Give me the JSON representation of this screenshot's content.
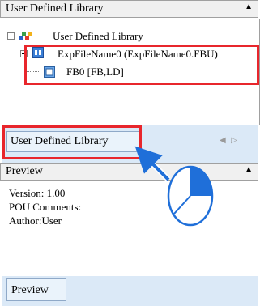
{
  "top_panel": {
    "title": "User Defined Library",
    "collapse_arrow": "▲"
  },
  "tree": {
    "root": {
      "label": "User Defined Library",
      "icon": "library-icon"
    },
    "file": {
      "label": "ExpFileName0 (ExpFileName0.FBU)",
      "icon": "file-module-icon"
    },
    "block": {
      "label": "FB0 [FB,LD]",
      "icon": "function-block-icon"
    }
  },
  "tabs": {
    "library_tab": "User Defined Library",
    "scroll_left": "◀",
    "scroll_right": "▷"
  },
  "preview_panel": {
    "title": "Preview",
    "collapse_arrow": "▲",
    "version": "Version: 1.00",
    "pou_comments": "POU Comments:",
    "author": "Author:User",
    "tab": "Preview"
  },
  "colors": {
    "highlight_red": "#e8262c",
    "pointer_blue": "#1f6fd9",
    "tab_bar": "#dbe9f7"
  }
}
